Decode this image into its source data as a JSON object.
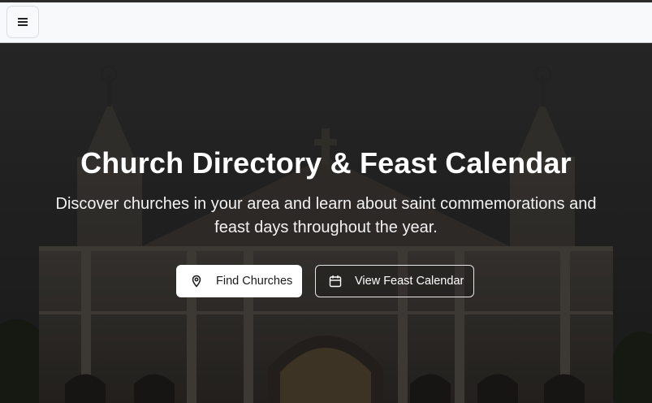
{
  "header": {
    "menu_icon": "hamburger-menu-icon"
  },
  "hero": {
    "title": "Church Directory & Feast Calendar",
    "subtitle": "Discover churches in your area and learn about saint commemorations and feast days throughout the year.",
    "background": "church-facade-photo",
    "buttons": [
      {
        "label": "Find Churches",
        "icon": "map-pin-icon"
      },
      {
        "label": "View Feast Calendar",
        "icon": "calendar-icon"
      }
    ]
  },
  "colors": {
    "topbar_bg": "#f8f9fb",
    "primary_button_bg": "#ffffff",
    "text_on_hero": "#ffffff"
  }
}
